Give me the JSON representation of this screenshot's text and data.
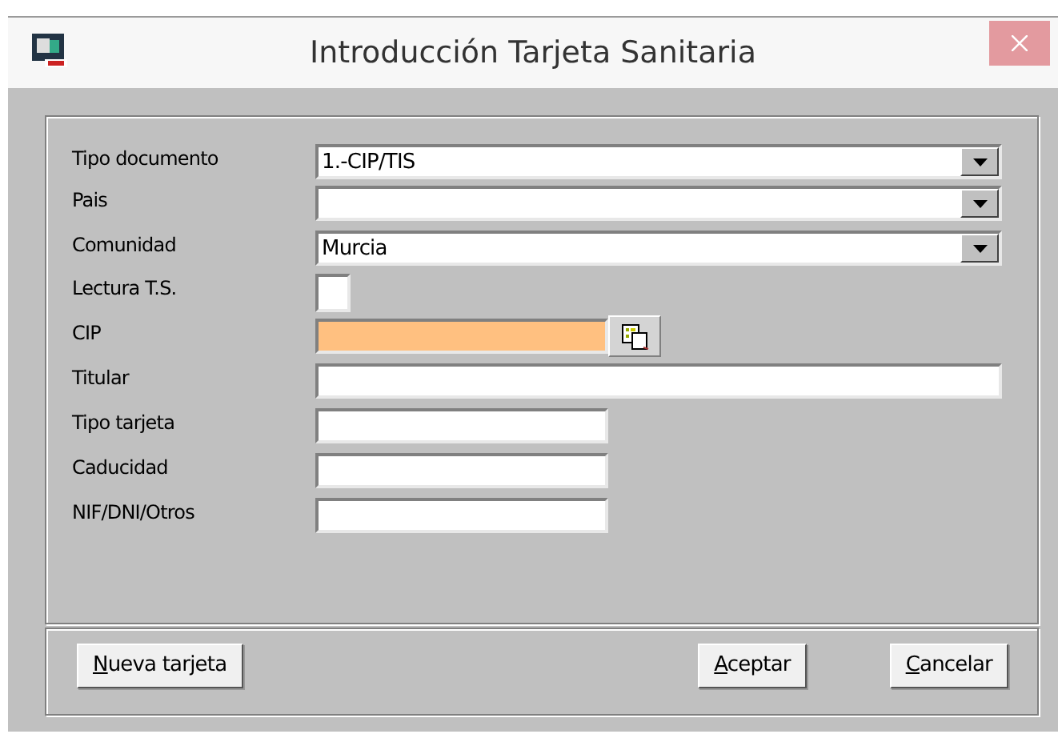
{
  "window": {
    "title": "Introducción Tarjeta Sanitaria"
  },
  "fields": [
    {
      "label": "Tipo documento",
      "kind": "combo",
      "value": "1.-CIP/TIS",
      "wide": true
    },
    {
      "label": "Pais",
      "kind": "combo",
      "wide": true
    },
    {
      "label": "Comunidad",
      "kind": "combo",
      "value": "Murcia",
      "wide": true
    },
    {
      "label": "Lectura T.S.",
      "kind": "checkbox",
      "checked": false
    },
    {
      "label": "CIP",
      "kind": "lookup",
      "highlighted": true,
      "wide": false
    },
    {
      "label": "Titular",
      "kind": "text",
      "wide": true
    },
    {
      "label": "Tipo tarjeta",
      "kind": "text",
      "wide": false
    },
    {
      "label": "Caducidad",
      "kind": "text",
      "wide": false
    },
    {
      "label": "NIF/DNI/Otros",
      "kind": "text",
      "wide": false
    }
  ],
  "buttons": [
    {
      "label": "Nueva tarjeta",
      "kind": "left"
    },
    {
      "label": "Aceptar",
      "kind": "right"
    },
    {
      "label": "Cancelar",
      "kind": "right"
    }
  ]
}
